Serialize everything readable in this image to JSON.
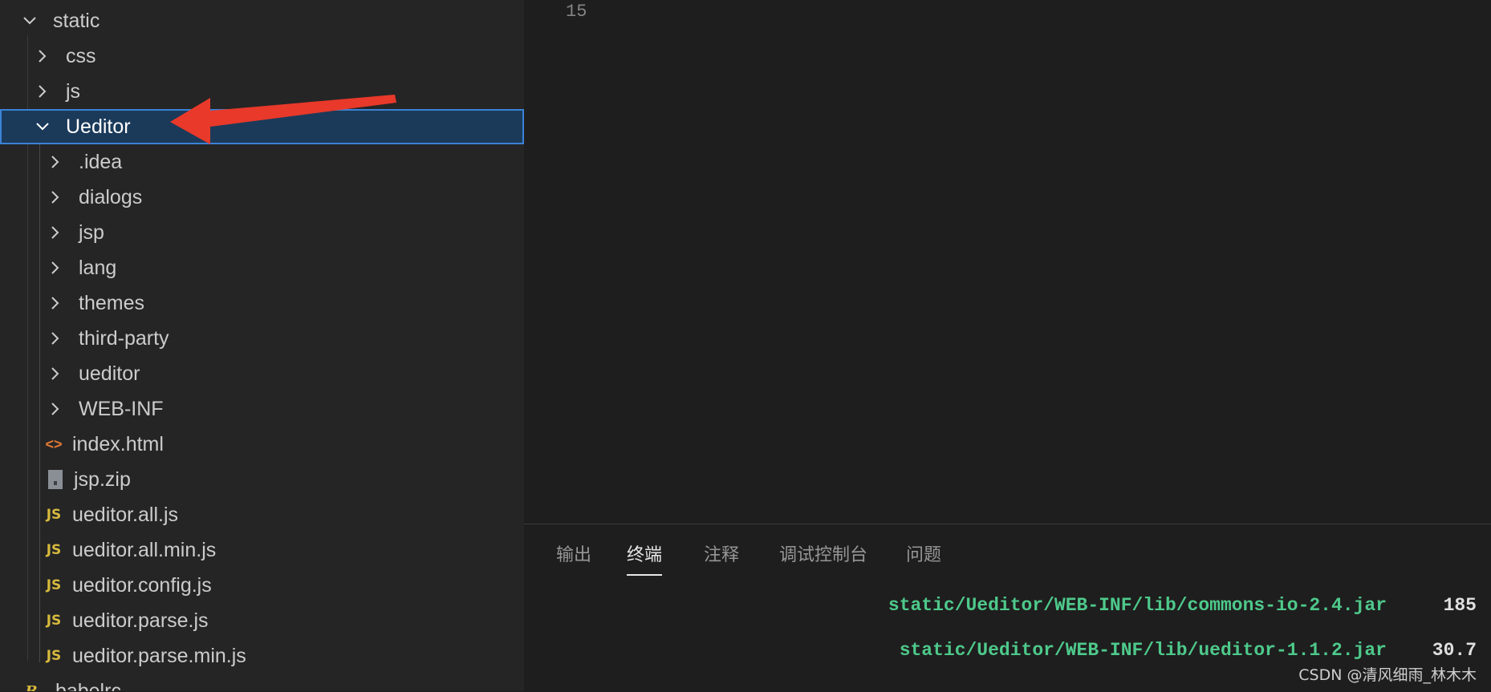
{
  "explorer": {
    "items": [
      {
        "label": "static",
        "kind": "folder-open",
        "depth": 0
      },
      {
        "label": "css",
        "kind": "folder",
        "depth": 1
      },
      {
        "label": "js",
        "kind": "folder",
        "depth": 1
      },
      {
        "label": "Ueditor",
        "kind": "folder-open",
        "depth": 1,
        "selected": true
      },
      {
        "label": ".idea",
        "kind": "folder",
        "depth": 2
      },
      {
        "label": "dialogs",
        "kind": "folder",
        "depth": 2
      },
      {
        "label": "jsp",
        "kind": "folder",
        "depth": 2
      },
      {
        "label": "lang",
        "kind": "folder",
        "depth": 2
      },
      {
        "label": "themes",
        "kind": "folder",
        "depth": 2
      },
      {
        "label": "third-party",
        "kind": "folder",
        "depth": 2
      },
      {
        "label": "ueditor",
        "kind": "folder",
        "depth": 2
      },
      {
        "label": "WEB-INF",
        "kind": "folder",
        "depth": 2
      },
      {
        "label": "index.html",
        "kind": "file-html",
        "icon_text": "<>",
        "depth": 2
      },
      {
        "label": "jsp.zip",
        "kind": "file-zip",
        "depth": 2
      },
      {
        "label": "ueditor.all.js",
        "kind": "file-js",
        "icon_text": "JS",
        "depth": 2
      },
      {
        "label": "ueditor.all.min.js",
        "kind": "file-js",
        "icon_text": "JS",
        "depth": 2
      },
      {
        "label": "ueditor.config.js",
        "kind": "file-js",
        "icon_text": "JS",
        "depth": 2
      },
      {
        "label": "ueditor.parse.js",
        "kind": "file-js",
        "icon_text": "JS",
        "depth": 2
      },
      {
        "label": "ueditor.parse.min.js",
        "kind": "file-js",
        "icon_text": "JS",
        "depth": 2
      },
      {
        "label": ".babelrc",
        "kind": "file-babel",
        "icon_text": "B",
        "depth": 0
      }
    ]
  },
  "editor": {
    "line_number": "15"
  },
  "panel": {
    "tabs": [
      {
        "label": "输出",
        "active": false
      },
      {
        "label": "终端",
        "active": true
      },
      {
        "label": "注释",
        "active": false
      },
      {
        "label": "调试控制台",
        "active": false
      },
      {
        "label": "问题",
        "active": false
      }
    ],
    "terminal_lines": [
      {
        "path": "static/Ueditor/WEB-INF/lib/commons-io-2.4.jar",
        "size": "185"
      },
      {
        "path": "static/Ueditor/WEB-INF/lib/ueditor-1.1.2.jar",
        "size": "30.7"
      }
    ]
  },
  "watermark": "CSDN @清风细雨_林木木",
  "colors": {
    "selection_bg": "#1b3a5a",
    "selection_border": "#3b82d6",
    "arrow": "#e8392a",
    "terminal_path": "#4ec98b",
    "js_icon": "#d7ba3d",
    "html_icon": "#e37933"
  }
}
